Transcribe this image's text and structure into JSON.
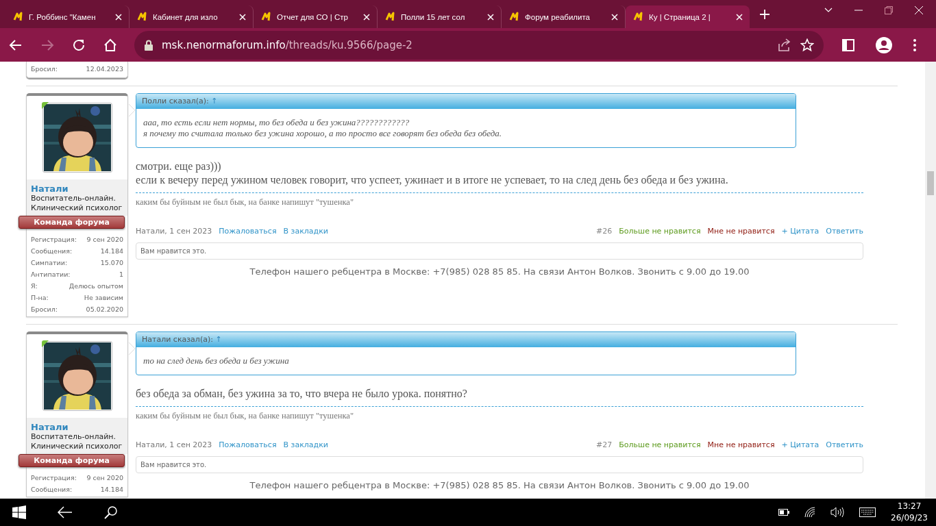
{
  "browser": {
    "tabs": [
      {
        "title": "Г. Роббинс \"Камен",
        "selected": false
      },
      {
        "title": "Кабинет для изло",
        "selected": false
      },
      {
        "title": "Отчет для СО | Стр",
        "selected": false
      },
      {
        "title": "Полли 15 лет сол",
        "selected": false
      },
      {
        "title": "Форум реабилита",
        "selected": false
      },
      {
        "title": "Ку | Страница 2 | ",
        "selected": true
      }
    ],
    "address": {
      "host": "msk.nenormaforum.info",
      "path": "/threads/ku.9566/page-2"
    },
    "forward_disabled": true
  },
  "previous_stats": [
    {
      "label": "Бросил:",
      "value": "12.04.2023"
    }
  ],
  "posts": [
    {
      "user": {
        "name": "Натали",
        "title": "Воспитатель-онлайн. Клинический психолог",
        "badge": "Команда форума",
        "online": true,
        "stats": [
          {
            "label": "Регистрация:",
            "value": "9 сен 2020"
          },
          {
            "label": "Сообщения:",
            "value": "14.184"
          },
          {
            "label": "Симпатии:",
            "value": "15.070"
          },
          {
            "label": "Антипатии:",
            "value": "1"
          },
          {
            "label": "Я:",
            "value": "Делюсь опытом"
          },
          {
            "label": "П-на:",
            "value": "Не зависим"
          },
          {
            "label": "Бросил:",
            "value": "05.02.2020"
          }
        ]
      },
      "quote": {
        "author": "Полли сказал(а):",
        "jump": "↑",
        "lines": [
          "ааа, то есть если нет нормы, то без обеда и без ужина????????????",
          "я почему то считала только без ужина хорошо, а то просто все говорят без обеда без обеда."
        ]
      },
      "body": [
        "смотри. еще раз)))",
        "если к вечеру перед ужином человек говорит, что успеет, ужинает и в итоге не успевает, то на след день без обеда и без ужина."
      ],
      "signature": "каким бы буйным не был бык, на банке напишут \"тушенка\"",
      "byline": "Натали, 1 сен 2023",
      "links": [
        "Пожаловаться",
        "В закладки"
      ],
      "number": "#26",
      "actions": [
        {
          "kind": "unlike",
          "label": "Больше не нравится"
        },
        {
          "kind": "dislike",
          "label": "Мне не нравится"
        },
        {
          "kind": "quote",
          "label": "+ Цитата"
        },
        {
          "kind": "reply",
          "label": "Ответить"
        }
      ],
      "likes": "Вам нравится это.",
      "notice": "Телефон нашего ребцентра в Москве: +7(985) 028 85 85. На связи Антон Волков. Звонить с 9.00 до 19.00"
    },
    {
      "user": {
        "name": "Натали",
        "title": "Воспитатель-онлайн. Клинический психолог",
        "badge": "Команда форума",
        "online": true,
        "stats": [
          {
            "label": "Регистрация:",
            "value": "9 сен 2020"
          },
          {
            "label": "Сообщения:",
            "value": "14.184"
          }
        ]
      },
      "quote": {
        "author": "Натали сказал(а):",
        "jump": "↑",
        "lines": [
          "то на след день без обеда и без ужина"
        ]
      },
      "body": [
        "без обеда за обман, без ужина за то, что вчера не было урока. понятно?"
      ],
      "signature": "каким бы буйным не был бык, на банке напишут \"тушенка\"",
      "byline": "Натали, 1 сен 2023",
      "links": [
        "Пожаловаться",
        "В закладки"
      ],
      "number": "#27",
      "actions": [
        {
          "kind": "unlike",
          "label": "Больше не нравится"
        },
        {
          "kind": "dislike",
          "label": "Мне не нравится"
        },
        {
          "kind": "quote",
          "label": "+ Цитата"
        },
        {
          "kind": "reply",
          "label": "Ответить"
        }
      ],
      "likes": "Вам нравится это.",
      "notice": "Телефон нашего ребцентра в Москве: +7(985) 028 85 85. На связи Антон Волков. Звонить с 9.00 до 19.00"
    }
  ],
  "taskbar": {
    "time": "13:27",
    "date": "26/09/23"
  }
}
